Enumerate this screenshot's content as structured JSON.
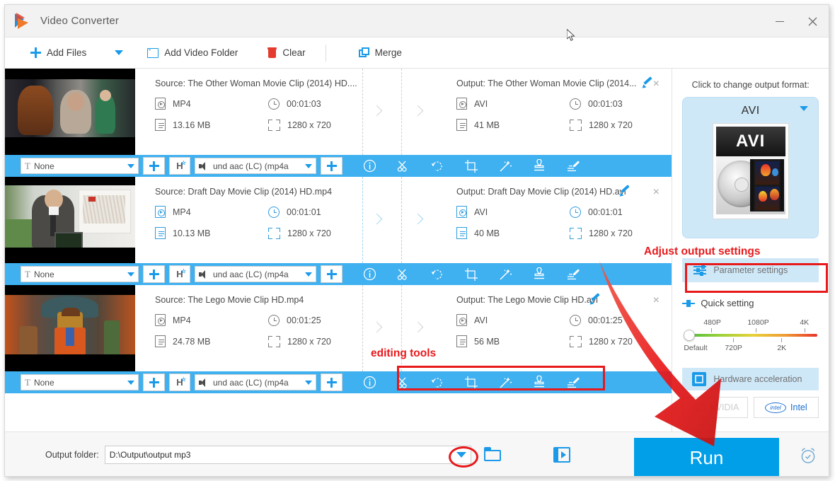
{
  "window": {
    "title": "Video Converter",
    "logo_icon": "app-logo-icon",
    "minimize_label": "–",
    "close_label": "×"
  },
  "toolbar": {
    "add_files": "Add Files",
    "add_files_caret": "chevron-down-icon",
    "add_video_folder": "Add Video Folder",
    "clear": "Clear",
    "merge": "Merge"
  },
  "files": [
    {
      "source_title": "Source: The Other Woman Movie Clip (2014) HD....",
      "source_format": "MP4",
      "source_duration": "00:01:03",
      "source_size": "13.16 MB",
      "source_resolution": "1280 x 720",
      "output_title": "Output: The Other Woman Movie Clip (2014...",
      "output_format": "AVI",
      "output_duration": "00:01:03",
      "output_size": "41 MB",
      "output_resolution": "1280 x 720",
      "subtitle_value": "None",
      "audio_value": "und aac (LC) (mp4a",
      "active": false
    },
    {
      "source_title": "Source: Draft Day Movie Clip  (2014) HD.mp4",
      "source_format": "MP4",
      "source_duration": "00:01:01",
      "source_size": "10.13 MB",
      "source_resolution": "1280 x 720",
      "output_title": "Output: Draft Day Movie Clip  (2014) HD.avi",
      "output_format": "AVI",
      "output_duration": "00:01:01",
      "output_size": "40 MB",
      "output_resolution": "1280 x 720",
      "subtitle_value": "None",
      "audio_value": "und aac (LC) (mp4a",
      "active": true
    },
    {
      "source_title": "Source: The Lego Movie Clip HD.mp4",
      "source_format": "MP4",
      "source_duration": "00:01:25",
      "source_size": "24.78 MB",
      "source_resolution": "1280 x 720",
      "output_title": "Output: The Lego Movie Clip HD.avi",
      "output_format": "AVI",
      "output_duration": "00:01:25",
      "output_size": "56 MB",
      "output_resolution": "1280 x 720",
      "subtitle_value": "None",
      "audio_value": "und aac (LC) (mp4a",
      "active": false
    }
  ],
  "editing_tools": [
    {
      "name": "info-icon",
      "title": "Info"
    },
    {
      "name": "scissors-icon",
      "title": "Trim"
    },
    {
      "name": "rotate-icon",
      "title": "Rotate"
    },
    {
      "name": "crop-icon",
      "title": "Crop"
    },
    {
      "name": "effects-wand-icon",
      "title": "Effects"
    },
    {
      "name": "watermark-stamp-icon",
      "title": "Watermark"
    },
    {
      "name": "subtitle-edit-icon",
      "title": "Subtitle"
    }
  ],
  "right_panel": {
    "hint": "Click to change output format:",
    "format_name": "AVI",
    "format_art_label": "AVI",
    "parameter_settings": "Parameter settings",
    "quick_setting": "Quick setting",
    "slider": {
      "top_labels": [
        "480P",
        "1080P",
        "4K"
      ],
      "bottom_labels": [
        "Default",
        "720P",
        "2K"
      ],
      "value": "Default"
    },
    "hardware_acceleration": "Hardware acceleration",
    "gpu_nvidia": "NVIDIA",
    "gpu_intel": "Intel"
  },
  "bottom": {
    "output_folder_label": "Output folder:",
    "output_folder_value": "D:\\Output\\output mp3",
    "folder_open_icon": "folder-icon",
    "open_video_folder_icon": "video-folder-icon",
    "run_label": "Run",
    "alarm_icon": "alarm-clock-icon"
  },
  "annotations": [
    {
      "text": "Adjust output settings",
      "target": "parameter-settings"
    },
    {
      "text": "editing tools",
      "target": "editing-toolbar"
    }
  ],
  "colors": {
    "accent": "#1a9ae8",
    "bluebar": "#3fb0f0",
    "run": "#019fe8",
    "annotation_red": "#e8191b",
    "panel_light_blue": "#cfe8f8"
  }
}
